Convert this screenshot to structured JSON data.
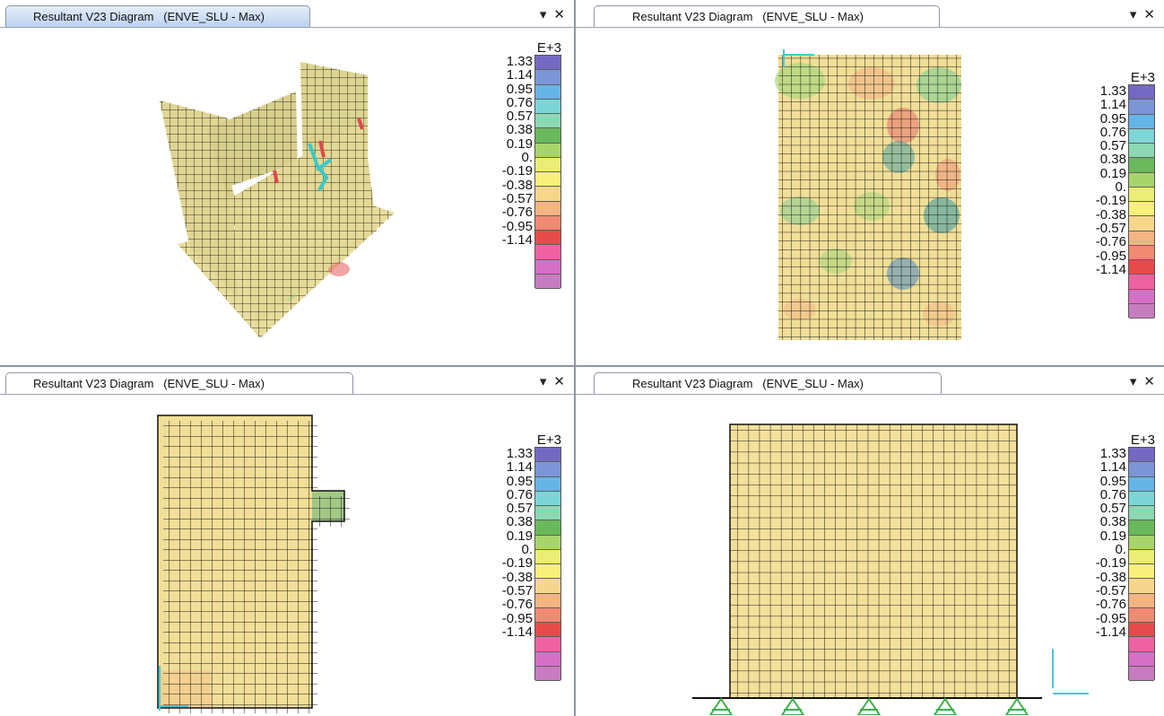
{
  "panes": [
    {
      "id": "top-left",
      "tab_title": "Resultant V23 Diagram   (ENVE_SLU - Max)",
      "active": true
    },
    {
      "id": "top-right",
      "tab_title": "Resultant V23 Diagram   (ENVE_SLU - Max)",
      "active": false
    },
    {
      "id": "bottom-left",
      "tab_title": "Resultant V23 Diagram   (ENVE_SLU - Max)",
      "active": false
    },
    {
      "id": "bottom-right",
      "tab_title": "Resultant V23 Diagram   (ENVE_SLU - Max)",
      "active": false
    }
  ],
  "controls": {
    "dropdown": "▾",
    "close": "✕"
  },
  "legend": {
    "exponent": "E+3",
    "values": [
      "1.33",
      "1.14",
      "0.95",
      "0.76",
      "0.57",
      "0.38",
      "0.19",
      "0.",
      "-0.19",
      "-0.38",
      "-0.57",
      "-0.76",
      "-0.95",
      "-1.14"
    ],
    "colors": [
      "#7468c2",
      "#7c95d6",
      "#66b4e6",
      "#7dd6d6",
      "#8bd8b2",
      "#6ab85c",
      "#a8d46c",
      "#eaee74",
      "#f8f07a",
      "#f7d68c",
      "#f4b483",
      "#f08a72",
      "#e84a4a",
      "#ee62a2",
      "#d66fc6",
      "#c87cc0"
    ]
  }
}
